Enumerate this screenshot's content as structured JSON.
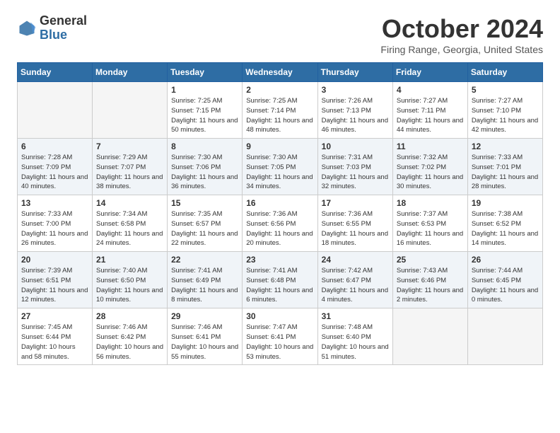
{
  "header": {
    "logo_general": "General",
    "logo_blue": "Blue",
    "month_title": "October 2024",
    "location": "Firing Range, Georgia, United States"
  },
  "days_of_week": [
    "Sunday",
    "Monday",
    "Tuesday",
    "Wednesday",
    "Thursday",
    "Friday",
    "Saturday"
  ],
  "weeks": [
    [
      {
        "day": "",
        "info": ""
      },
      {
        "day": "",
        "info": ""
      },
      {
        "day": "1",
        "info": "Sunrise: 7:25 AM\nSunset: 7:15 PM\nDaylight: 11 hours and 50 minutes."
      },
      {
        "day": "2",
        "info": "Sunrise: 7:25 AM\nSunset: 7:14 PM\nDaylight: 11 hours and 48 minutes."
      },
      {
        "day": "3",
        "info": "Sunrise: 7:26 AM\nSunset: 7:13 PM\nDaylight: 11 hours and 46 minutes."
      },
      {
        "day": "4",
        "info": "Sunrise: 7:27 AM\nSunset: 7:11 PM\nDaylight: 11 hours and 44 minutes."
      },
      {
        "day": "5",
        "info": "Sunrise: 7:27 AM\nSunset: 7:10 PM\nDaylight: 11 hours and 42 minutes."
      }
    ],
    [
      {
        "day": "6",
        "info": "Sunrise: 7:28 AM\nSunset: 7:09 PM\nDaylight: 11 hours and 40 minutes."
      },
      {
        "day": "7",
        "info": "Sunrise: 7:29 AM\nSunset: 7:07 PM\nDaylight: 11 hours and 38 minutes."
      },
      {
        "day": "8",
        "info": "Sunrise: 7:30 AM\nSunset: 7:06 PM\nDaylight: 11 hours and 36 minutes."
      },
      {
        "day": "9",
        "info": "Sunrise: 7:30 AM\nSunset: 7:05 PM\nDaylight: 11 hours and 34 minutes."
      },
      {
        "day": "10",
        "info": "Sunrise: 7:31 AM\nSunset: 7:03 PM\nDaylight: 11 hours and 32 minutes."
      },
      {
        "day": "11",
        "info": "Sunrise: 7:32 AM\nSunset: 7:02 PM\nDaylight: 11 hours and 30 minutes."
      },
      {
        "day": "12",
        "info": "Sunrise: 7:33 AM\nSunset: 7:01 PM\nDaylight: 11 hours and 28 minutes."
      }
    ],
    [
      {
        "day": "13",
        "info": "Sunrise: 7:33 AM\nSunset: 7:00 PM\nDaylight: 11 hours and 26 minutes."
      },
      {
        "day": "14",
        "info": "Sunrise: 7:34 AM\nSunset: 6:58 PM\nDaylight: 11 hours and 24 minutes."
      },
      {
        "day": "15",
        "info": "Sunrise: 7:35 AM\nSunset: 6:57 PM\nDaylight: 11 hours and 22 minutes."
      },
      {
        "day": "16",
        "info": "Sunrise: 7:36 AM\nSunset: 6:56 PM\nDaylight: 11 hours and 20 minutes."
      },
      {
        "day": "17",
        "info": "Sunrise: 7:36 AM\nSunset: 6:55 PM\nDaylight: 11 hours and 18 minutes."
      },
      {
        "day": "18",
        "info": "Sunrise: 7:37 AM\nSunset: 6:53 PM\nDaylight: 11 hours and 16 minutes."
      },
      {
        "day": "19",
        "info": "Sunrise: 7:38 AM\nSunset: 6:52 PM\nDaylight: 11 hours and 14 minutes."
      }
    ],
    [
      {
        "day": "20",
        "info": "Sunrise: 7:39 AM\nSunset: 6:51 PM\nDaylight: 11 hours and 12 minutes."
      },
      {
        "day": "21",
        "info": "Sunrise: 7:40 AM\nSunset: 6:50 PM\nDaylight: 11 hours and 10 minutes."
      },
      {
        "day": "22",
        "info": "Sunrise: 7:41 AM\nSunset: 6:49 PM\nDaylight: 11 hours and 8 minutes."
      },
      {
        "day": "23",
        "info": "Sunrise: 7:41 AM\nSunset: 6:48 PM\nDaylight: 11 hours and 6 minutes."
      },
      {
        "day": "24",
        "info": "Sunrise: 7:42 AM\nSunset: 6:47 PM\nDaylight: 11 hours and 4 minutes."
      },
      {
        "day": "25",
        "info": "Sunrise: 7:43 AM\nSunset: 6:46 PM\nDaylight: 11 hours and 2 minutes."
      },
      {
        "day": "26",
        "info": "Sunrise: 7:44 AM\nSunset: 6:45 PM\nDaylight: 11 hours and 0 minutes."
      }
    ],
    [
      {
        "day": "27",
        "info": "Sunrise: 7:45 AM\nSunset: 6:44 PM\nDaylight: 10 hours and 58 minutes."
      },
      {
        "day": "28",
        "info": "Sunrise: 7:46 AM\nSunset: 6:42 PM\nDaylight: 10 hours and 56 minutes."
      },
      {
        "day": "29",
        "info": "Sunrise: 7:46 AM\nSunset: 6:41 PM\nDaylight: 10 hours and 55 minutes."
      },
      {
        "day": "30",
        "info": "Sunrise: 7:47 AM\nSunset: 6:41 PM\nDaylight: 10 hours and 53 minutes."
      },
      {
        "day": "31",
        "info": "Sunrise: 7:48 AM\nSunset: 6:40 PM\nDaylight: 10 hours and 51 minutes."
      },
      {
        "day": "",
        "info": ""
      },
      {
        "day": "",
        "info": ""
      }
    ]
  ]
}
